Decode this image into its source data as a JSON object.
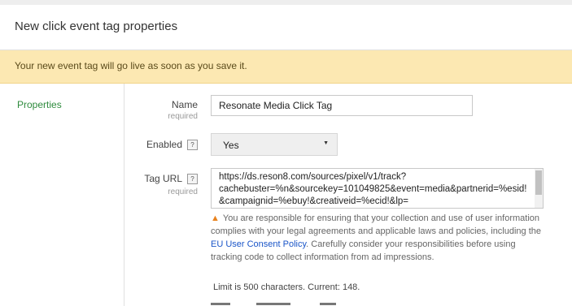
{
  "header": {
    "title": "New click event tag properties"
  },
  "banner": {
    "text": "Your new event tag will go live as soon as you save it."
  },
  "nav": {
    "properties": "Properties"
  },
  "form": {
    "name": {
      "label": "Name",
      "required": "required",
      "value": "Resonate Media Click Tag"
    },
    "enabled": {
      "label": "Enabled",
      "help": "?",
      "value": "Yes"
    },
    "tag_url": {
      "label": "Tag URL",
      "help": "?",
      "required": "required",
      "value_lines": [
        "https://ds.reson8.com/sources/pixel/v1/track?",
        "cachebuster=%n&sourcekey=101049825&event=media&partnerid=%esid!",
        "&campaignid=%ebuy!&creativeid=%ecid!&lp="
      ]
    },
    "warning": {
      "icon": "warning-icon",
      "text_before": "You are responsible for ensuring that your collection and use of user information complies with your legal agreements and applicable laws and policies, including the ",
      "link": "EU User Consent Policy",
      "text_after": ". Carefully consider your responsibilities before using tracking code to collect information from ad impressions."
    },
    "limit": "Limit is 500 characters. Current: 148."
  },
  "colors": {
    "banner_bg": "#fce8b2",
    "nav_accent": "#2e8b3d",
    "link": "#1a55c8",
    "warning_icon": "#e8821e"
  }
}
